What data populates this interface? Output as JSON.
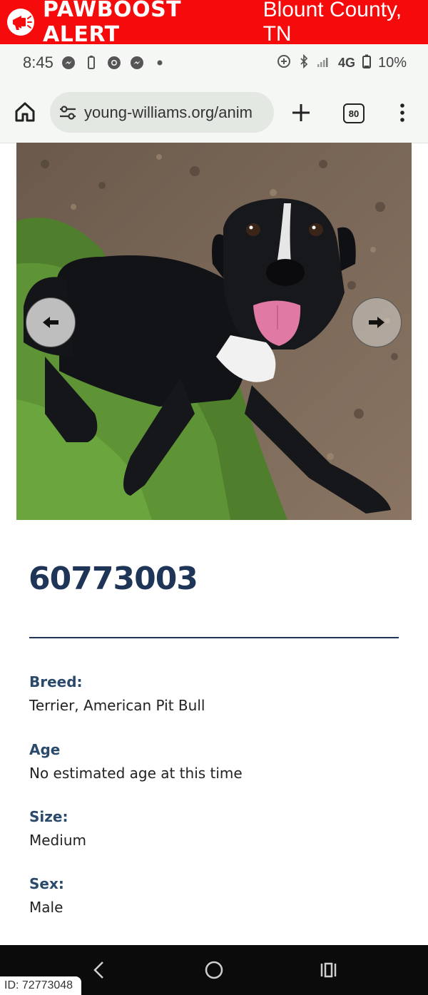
{
  "banner": {
    "brand": "PAWBOOST ALERT",
    "location": "Blount County, TN",
    "color": "#f50b0b"
  },
  "status": {
    "time": "8:45",
    "network": "4G",
    "battery": "10%"
  },
  "browser": {
    "url": "young-williams.org/anim",
    "tab_count": "80"
  },
  "pet": {
    "id": "60773003",
    "fields": [
      {
        "label": "Breed:",
        "value": "Terrier, American Pit Bull"
      },
      {
        "label": "Age",
        "value": "No estimated age at this time"
      },
      {
        "label": "Size:",
        "value": "Medium"
      },
      {
        "label": "Sex:",
        "value": "Male"
      }
    ]
  },
  "watermark": {
    "id_text": "ID: 72773048"
  }
}
